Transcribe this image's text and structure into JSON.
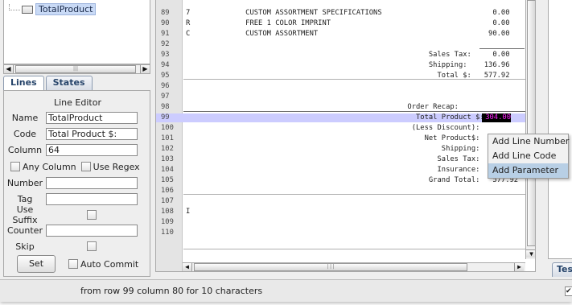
{
  "tree": {
    "item_label": "TotalProduct"
  },
  "tabs": [
    {
      "label": "Lines"
    },
    {
      "label": "States"
    }
  ],
  "editor": {
    "title": "Line Editor",
    "name_label": "Name",
    "name_value": "TotalProduct",
    "code_label": "Code",
    "code_value": "Total Product $:",
    "column_label": "Column",
    "column_value": "64",
    "any_column_label": "Any Column",
    "use_regex_label": "Use Regex",
    "number_label": "Number",
    "number_value": "",
    "tag_label": "Tag",
    "tag_value": "",
    "use_suffix_label": "Use Suffix",
    "counter_label": "Counter",
    "counter_value": "",
    "skip_label": "Skip",
    "set_label": "Set",
    "auto_commit_label": "Auto Commit"
  },
  "status": {
    "text": "from row 99 column 80 for 10 characters"
  },
  "code_lines": [
    {
      "num": "89",
      "text": "7             CUSTOM ASSORTMENT SPECIFICATIONS                          0.00"
    },
    {
      "num": "90",
      "text": "R             FREE 1 COLOR IMPRINT                                      0.00"
    },
    {
      "num": "91",
      "text": "C             CUSTOM ASSORTMENT                                        90.00"
    },
    {
      "num": "92",
      "text": ""
    },
    {
      "num": "93",
      "text": "                                                         Sales Tax:     0.00"
    },
    {
      "num": "94",
      "text": "                                                         Shipping:    136.96"
    },
    {
      "num": "95",
      "text": "                                                           Total $:   577.92"
    },
    {
      "num": "96",
      "text": ""
    },
    {
      "num": "97",
      "text": ""
    },
    {
      "num": "98",
      "text": "                                                    Order Recap:"
    },
    {
      "num": "99",
      "text": "                                                      Total Product $:"
    },
    {
      "num": "100",
      "text": "                                                     (Less Discount):"
    },
    {
      "num": "101",
      "text": "                                                        Net Product$:"
    },
    {
      "num": "102",
      "text": "                                                            Shipping:"
    },
    {
      "num": "103",
      "text": "                                                           Sales Tax:"
    },
    {
      "num": "104",
      "text": "                                                           Insurance:     0.00"
    },
    {
      "num": "105",
      "text": "                                                         Grand Total:   577.92"
    },
    {
      "num": "106",
      "text": ""
    },
    {
      "num": "107",
      "text": ""
    },
    {
      "num": "108",
      "text": "I"
    },
    {
      "num": "109",
      "text": ""
    },
    {
      "num": "110",
      "text": ""
    }
  ],
  "selected_value": "304.00",
  "right_tab": {
    "label": "Tes"
  },
  "context_menu": {
    "items": [
      {
        "label": "Add Line Number"
      },
      {
        "label": "Add Line Code"
      },
      {
        "label": "Add Parameter"
      }
    ]
  },
  "colors": {
    "row_highlight": "#ccccff",
    "selection_bg": "#000000",
    "selection_fg": "#ff20ff",
    "menu_hover": "#b8cfe5"
  }
}
